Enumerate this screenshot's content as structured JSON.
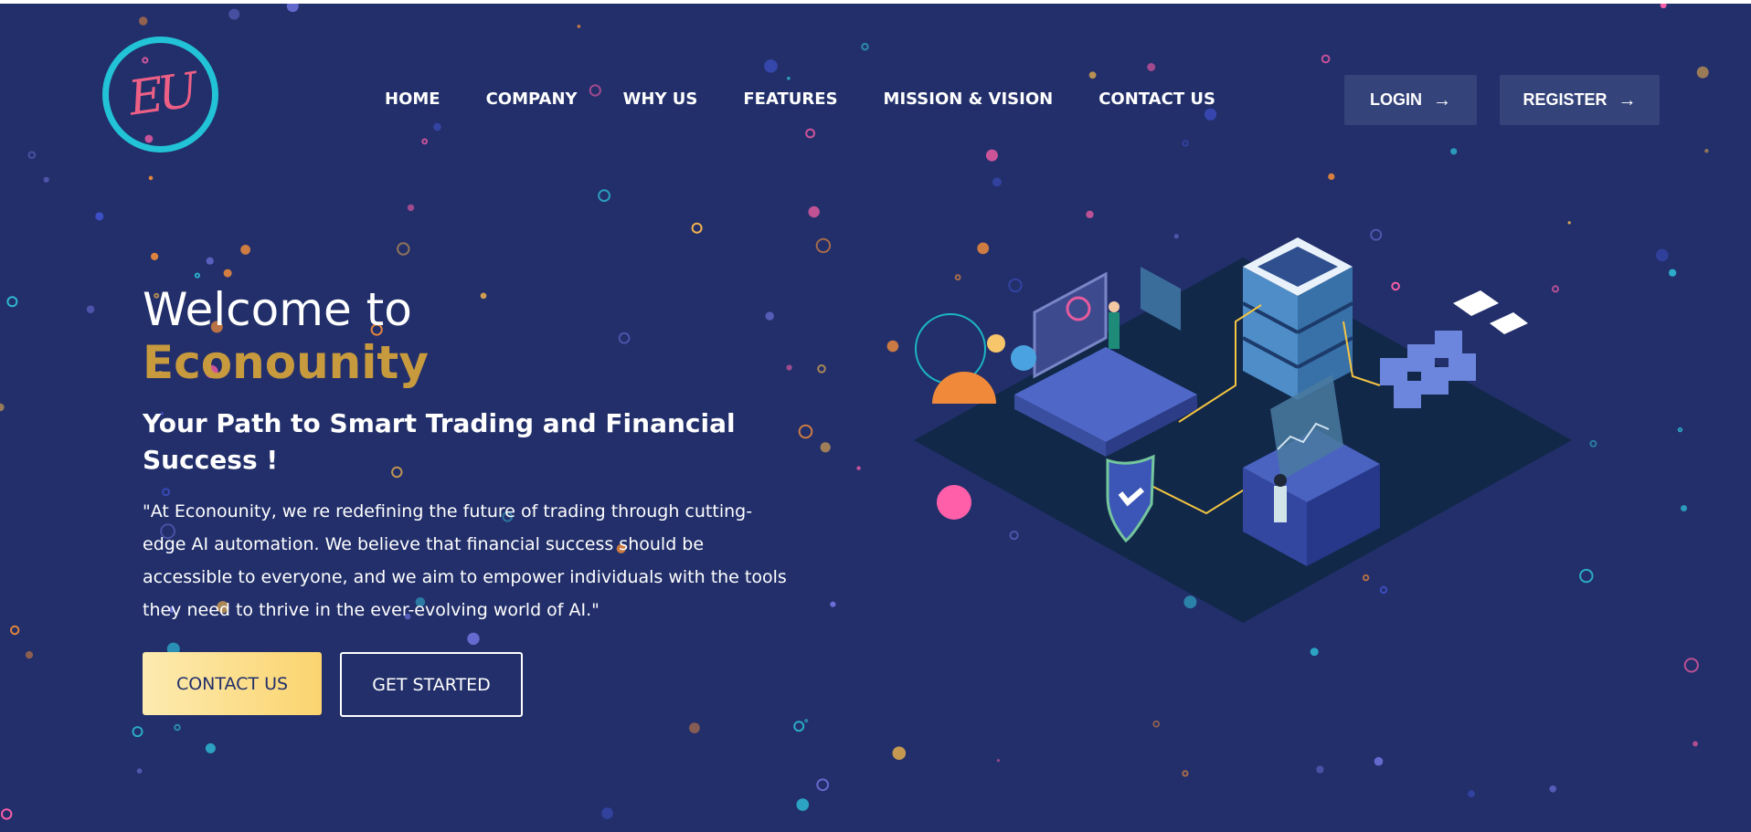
{
  "brand": {
    "logo_text": "EU",
    "name": "Econounity"
  },
  "nav": {
    "items": [
      {
        "label": "HOME"
      },
      {
        "label": "COMPANY"
      },
      {
        "label": "WHY US"
      },
      {
        "label": "FEATURES"
      },
      {
        "label": "MISSION & VISION"
      },
      {
        "label": "CONTACT US"
      }
    ],
    "login_label": "LOGIN",
    "register_label": "REGISTER"
  },
  "hero": {
    "welcome": "Welcome to",
    "brand_name": "Econounity",
    "tagline": "Your Path to Smart Trading and Financial Success !",
    "description": "\"At Econounity, we re redefining the future of trading through cutting-edge AI automation. We believe that financial success should be accessible to everyone, and we aim to empower individuals with the tools they need to thrive in the ever-evolving world of AI.\"",
    "contact_label": "CONTACT US",
    "start_label": "GET STARTED"
  },
  "icons": {
    "login_arrow": "arrow-right-icon",
    "register_arrow": "arrow-right-icon"
  },
  "colors": {
    "background": "#222f6a",
    "accent_gold": "#c89a3e",
    "logo_ring": "#22c3d6",
    "logo_letters": "#ee5f86",
    "button_gradient_start": "#fcebb0",
    "button_gradient_end": "#fbd46f"
  }
}
